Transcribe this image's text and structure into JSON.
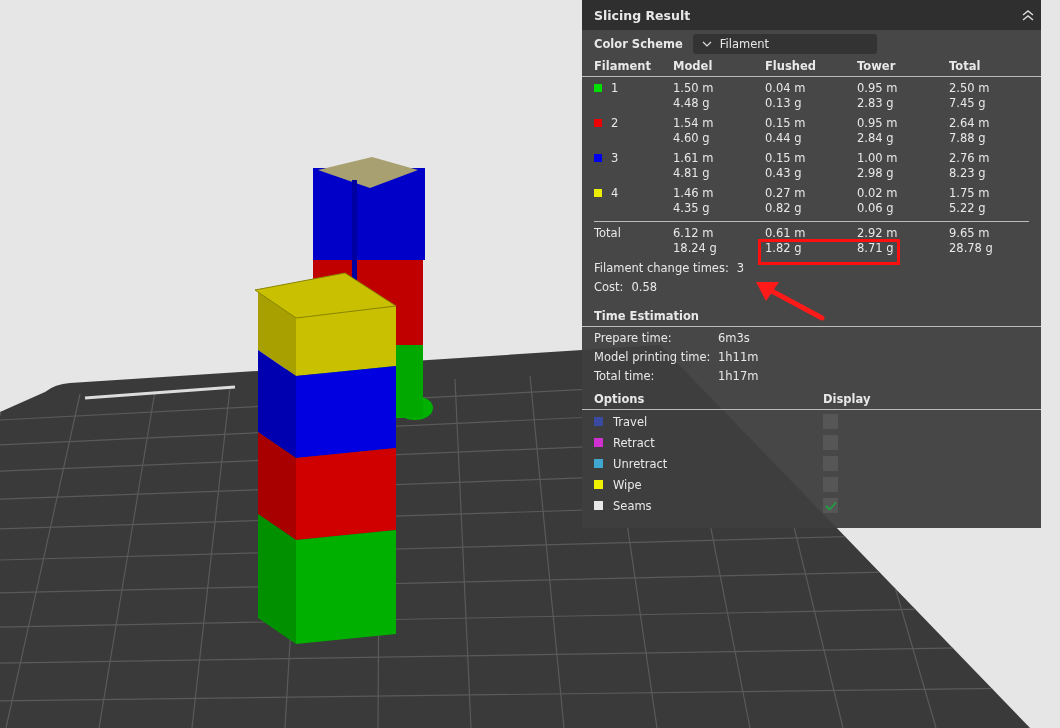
{
  "panel": {
    "title": "Slicing Result",
    "expanded": true,
    "color_scheme": {
      "label": "Color Scheme",
      "value": "Filament"
    },
    "columns": [
      "Filament",
      "Model",
      "Flushed",
      "Tower",
      "Total"
    ],
    "rows": [
      {
        "color": "#00e000",
        "filament": "1",
        "model": [
          "1.50 m",
          "4.48 g"
        ],
        "flushed": [
          "0.04 m",
          "0.13 g"
        ],
        "tower": [
          "0.95 m",
          "2.83 g"
        ],
        "total": [
          "2.50 m",
          "7.45 g"
        ]
      },
      {
        "color": "#ee0000",
        "filament": "2",
        "model": [
          "1.54 m",
          "4.60 g"
        ],
        "flushed": [
          "0.15 m",
          "0.44 g"
        ],
        "tower": [
          "0.95 m",
          "2.84 g"
        ],
        "total": [
          "2.64 m",
          "7.88 g"
        ]
      },
      {
        "color": "#0000ee",
        "filament": "3",
        "model": [
          "1.61 m",
          "4.81 g"
        ],
        "flushed": [
          "0.15 m",
          "0.43 g"
        ],
        "tower": [
          "1.00 m",
          "2.98 g"
        ],
        "total": [
          "2.76 m",
          "8.23 g"
        ]
      },
      {
        "color": "#eeee00",
        "filament": "4",
        "model": [
          "1.46 m",
          "4.35 g"
        ],
        "flushed": [
          "0.27 m",
          "0.82 g"
        ],
        "tower": [
          "0.02 m",
          "0.06 g"
        ],
        "total": [
          "1.75 m",
          "5.22 g"
        ]
      }
    ],
    "total": {
      "label": "Total",
      "model": [
        "6.12 m",
        "18.24 g"
      ],
      "flushed": [
        "0.61 m",
        "1.82 g"
      ],
      "tower": [
        "2.92 m",
        "8.71 g"
      ],
      "total": [
        "9.65 m",
        "28.78 g"
      ]
    },
    "filament_change": {
      "label": "Filament change times:",
      "value": "3"
    },
    "cost": {
      "label": "Cost:",
      "value": "0.58"
    },
    "time_estimation": {
      "title": "Time Estimation",
      "rows": [
        {
          "label": "Prepare time:",
          "value": "6m3s"
        },
        {
          "label": "Model printing time:",
          "value": "1h11m"
        },
        {
          "label": "Total time:",
          "value": "1h17m"
        }
      ]
    },
    "options": {
      "columns": [
        "Options",
        "Display"
      ],
      "items": [
        {
          "label": "Travel",
          "color": "#3a4aa0",
          "checked": false
        },
        {
          "label": "Retract",
          "color": "#d030d0",
          "checked": false
        },
        {
          "label": "Unretract",
          "color": "#40a8d0",
          "checked": false
        },
        {
          "label": "Wipe",
          "color": "#f0f000",
          "checked": false
        },
        {
          "label": "Seams",
          "color": "#e8e8e8",
          "checked": true
        }
      ]
    }
  }
}
